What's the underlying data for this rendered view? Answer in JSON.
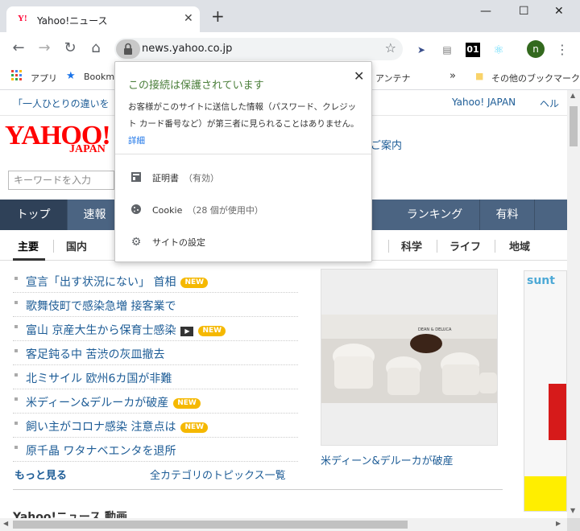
{
  "window": {
    "tab_title": "Yahoo!ニュース",
    "tab_favicon": "Y!",
    "minimize_glyph": "—",
    "maximize_glyph": "☐",
    "close_glyph": "✕"
  },
  "toolbar": {
    "url": "news.yahoo.co.jp",
    "extension_01": "01",
    "avatar_initial": "n"
  },
  "bookmarks": {
    "apps": "アプリ",
    "bookmarks_prefix": "Bookm",
    "antenna": "アンテナ",
    "chevron": "»",
    "other": "その他のブックマーク"
  },
  "page": {
    "top_message": "「一人ひとりの違いを",
    "yahoo_japan_link": "Yahoo! JAPAN",
    "help_link": "ヘル",
    "logo_main": "YAHOO!",
    "logo_sub": "JAPAN",
    "guide_link": "ご案内",
    "search_placeholder": "キーワードを入力",
    "nav_tabs": [
      {
        "label": "トップ"
      },
      {
        "label": "速報"
      },
      {
        "label": "ランキング"
      },
      {
        "label": "有料"
      }
    ],
    "sub_nav": [
      {
        "label": "主要"
      },
      {
        "label": "国内"
      },
      {
        "label": "科学"
      },
      {
        "label": "ライフ"
      },
      {
        "label": "地域"
      }
    ],
    "news": [
      {
        "text": "宣言「出す状況にない」 首相",
        "new": "NEW"
      },
      {
        "text": "歌舞伎町で感染急増 接客業で"
      },
      {
        "text": "富山 京産大生から保育士感染",
        "video": "▶",
        "new": "NEW"
      },
      {
        "text": "客足鈍る中 苦渋の灰皿撤去"
      },
      {
        "text": "北ミサイル 欧州6カ国が非難"
      },
      {
        "text": "米ディーン&デルーカが破産",
        "new": "NEW"
      },
      {
        "text": "飼い主がコロナ感染 注意点は",
        "new": "NEW"
      },
      {
        "text": "原千晶 ワタナベエンタを退所"
      }
    ],
    "more_link": "もっと見る",
    "all_categories_link": "全カテゴリのトピックス一覧",
    "photo_caption": "米ディーン&デルーカが破産",
    "photo_brand": "DEAN & DELUCA",
    "ad_title": "sunt",
    "cutoff_heading": "Yahoo!ニュース 動画"
  },
  "popup": {
    "title": "この接続は保護されています",
    "body": "お客様がこのサイトに送信した情報（パスワード、クレジット カード番号など）が第三者に見られることはありません。",
    "details_link": "詳細",
    "certificate_label": "証明書",
    "certificate_status": "（有効）",
    "cookie_label": "Cookie",
    "cookie_status": "（28 個が使用中）",
    "site_settings_label": "サイトの設定"
  }
}
